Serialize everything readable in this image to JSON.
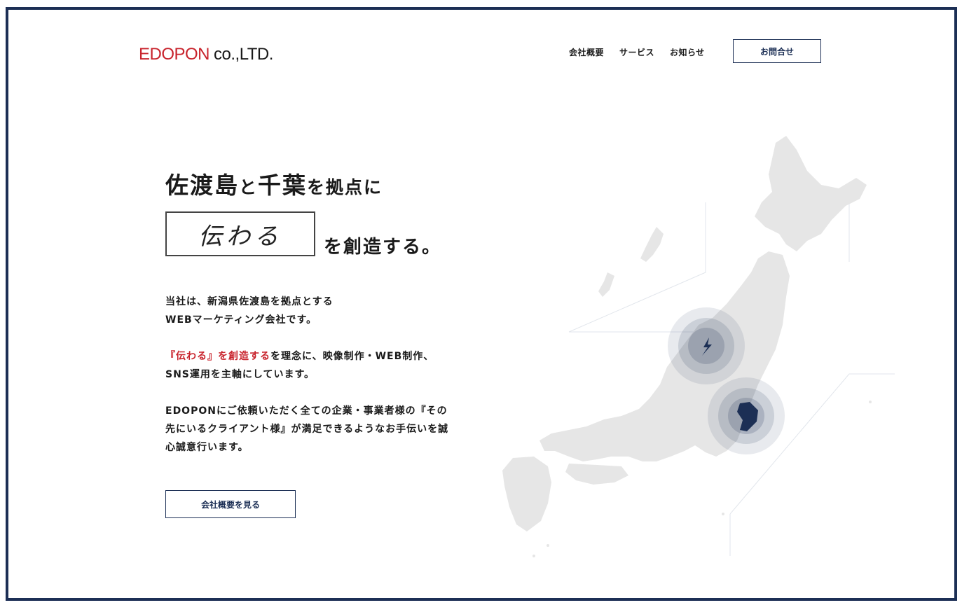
{
  "header": {
    "logo_red": "EDOPON",
    "logo_dark": "co.,LTD.",
    "nav": [
      "会社概要",
      "サービス",
      "お知らせ"
    ],
    "contact_label": "お問合せ"
  },
  "hero": {
    "headline_a": "佐渡島",
    "headline_b": "と",
    "headline_c": "千葉",
    "headline_d": "を拠点に",
    "brush_text": "伝わる",
    "headline_e": "を創造する。"
  },
  "intro": {
    "line1": "当社は、新潟県佐渡島を拠点とする",
    "line2": "WEBマーケティング会社です。",
    "line3_red": "『伝わる』を創造する",
    "line3_rest": "を理念に、映像制作・WEB制作、",
    "line4": "SNS運用を主軸にしています。",
    "line5": "EDOPONにご依頼いただく全ての企業・事業者様の『その",
    "line6": "先にいるクライアント様』が満足できるようなお手伝いを誠",
    "line7": "心誠意行います。"
  },
  "cta": {
    "about_label": "会社概要を見る"
  },
  "colors": {
    "accent": "#c8232c",
    "navy": "#1c2f55",
    "map": "#e6e6e6"
  }
}
